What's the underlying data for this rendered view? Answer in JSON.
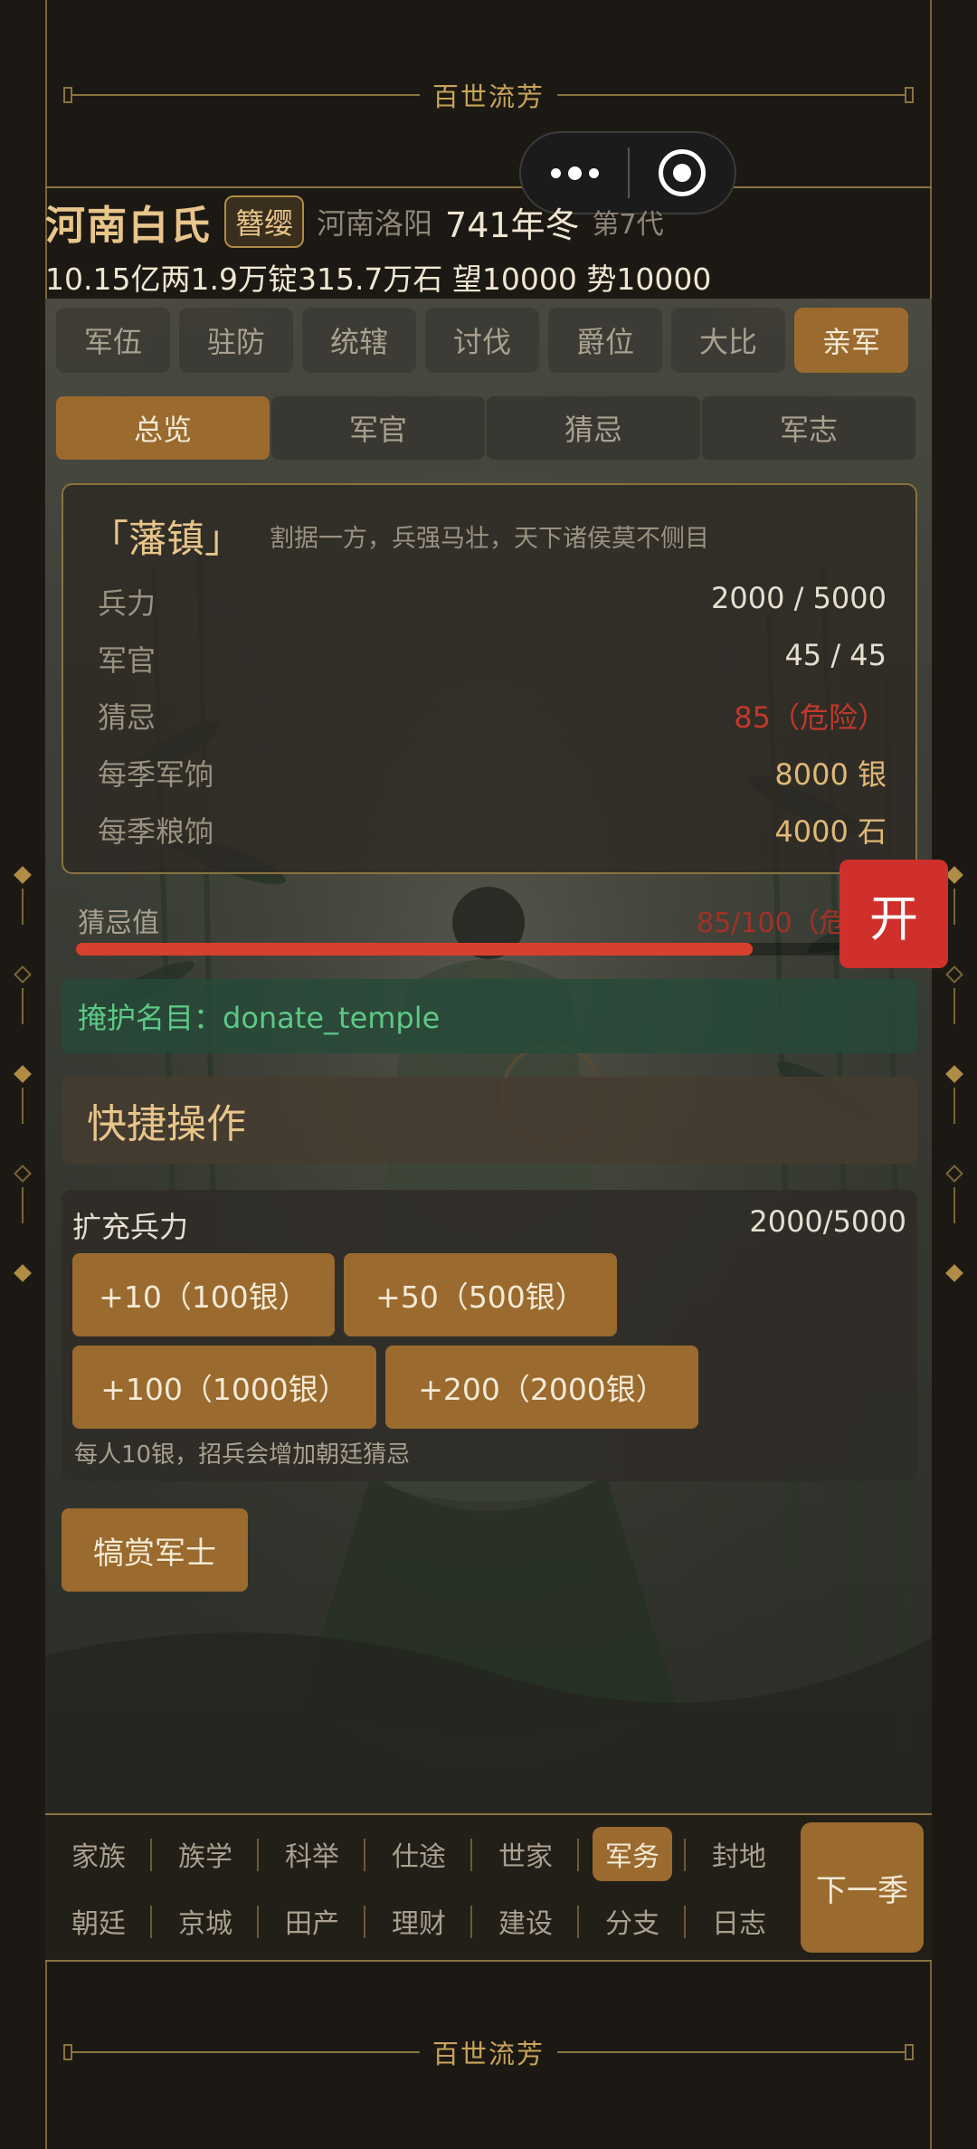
{
  "brand": {
    "title": "百世流芳"
  },
  "header": {
    "family": "河南白氏",
    "rank": "簪缨",
    "location": "河南洛阳",
    "year": "741年冬",
    "generation": "第7代",
    "resources": "10.15亿两1.9万锭315.7万石  望10000  势10000"
  },
  "tabs": [
    {
      "label": "军伍"
    },
    {
      "label": "驻防"
    },
    {
      "label": "统辖"
    },
    {
      "label": "讨伐"
    },
    {
      "label": "爵位"
    },
    {
      "label": "大比"
    },
    {
      "label": "亲军"
    }
  ],
  "subtabs": [
    {
      "label": "总览"
    },
    {
      "label": "军官"
    },
    {
      "label": "猜忌"
    },
    {
      "label": "军志"
    }
  ],
  "card": {
    "title": "「藩镇」",
    "desc": "割据一方，兵强马壮，天下诸侯莫不侧目",
    "stats": [
      {
        "key": "兵力",
        "value": "2000 / 5000"
      },
      {
        "key": "军官",
        "value": "45 / 45"
      },
      {
        "key": "猜忌",
        "value": "85（危险）"
      },
      {
        "key": "每季军饷",
        "value": "8000 银"
      },
      {
        "key": "每季粮饷",
        "value": "4000 石"
      }
    ]
  },
  "suspicion": {
    "label": "猜忌值",
    "value_text": "85/100（危",
    "level": 0.85
  },
  "cover": {
    "text": "掩护名目：donate_temple"
  },
  "quick": {
    "title": "快捷操作"
  },
  "recruit": {
    "title": "扩充兵力",
    "count": "2000/5000",
    "buttons": [
      "+10（100银）",
      "+50（500银）",
      "+100（1000银）",
      "+200（2000银）"
    ],
    "note": "每人10银，招兵会增加朝廷猜忌"
  },
  "reward_button": "犒赏军士",
  "open_button": "开",
  "bottom_nav": {
    "row1": [
      "家族",
      "族学",
      "科举",
      "仕途",
      "世家",
      "军务",
      "封地"
    ],
    "row2": [
      "朝廷",
      "京城",
      "田产",
      "理财",
      "建设",
      "分支",
      "日志"
    ],
    "next": "下一季"
  },
  "colors": {
    "accent": "#9a6a2e",
    "gold": "#e8c58a",
    "danger": "#d0302c",
    "cover_green": "#5dc985"
  }
}
